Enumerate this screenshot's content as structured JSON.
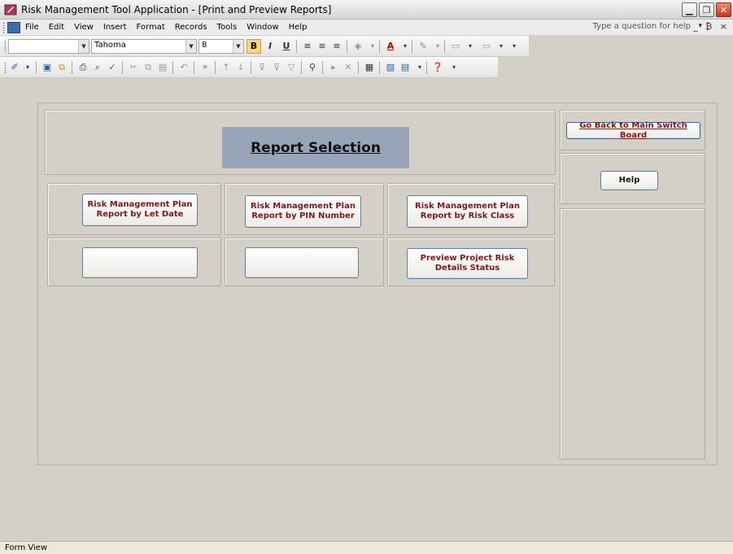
{
  "window": {
    "title": "Risk Management Tool Application - [Print and Preview Reports]",
    "min_glyph": "▁",
    "max_glyph": "❐",
    "close_glyph": "✕"
  },
  "menu": {
    "items": [
      "File",
      "Edit",
      "View",
      "Insert",
      "Format",
      "Records",
      "Tools",
      "Window",
      "Help"
    ],
    "help_placeholder": "Type a question for help",
    "help_dropdown": "▾",
    "window_controls": "_ ₿ ×"
  },
  "format_toolbar": {
    "object_combo": "",
    "font_name": "Tahoma",
    "font_size": "8",
    "bold": "B",
    "italic": "I",
    "underline": "U"
  },
  "form": {
    "heading": "Report Selection",
    "buttons": {
      "let_date": "Risk Management Plan Report by Let Date",
      "pin_number": "Risk Management Plan Report by PIN Number",
      "risk_class": "Risk Management Plan Report by Risk Class",
      "blank1": "",
      "blank2": "",
      "project_risk": "Preview Project Risk Details Status",
      "back_main": "Go Back to Main Switch Board",
      "help": "Help"
    }
  },
  "status": {
    "text": "Form View"
  }
}
